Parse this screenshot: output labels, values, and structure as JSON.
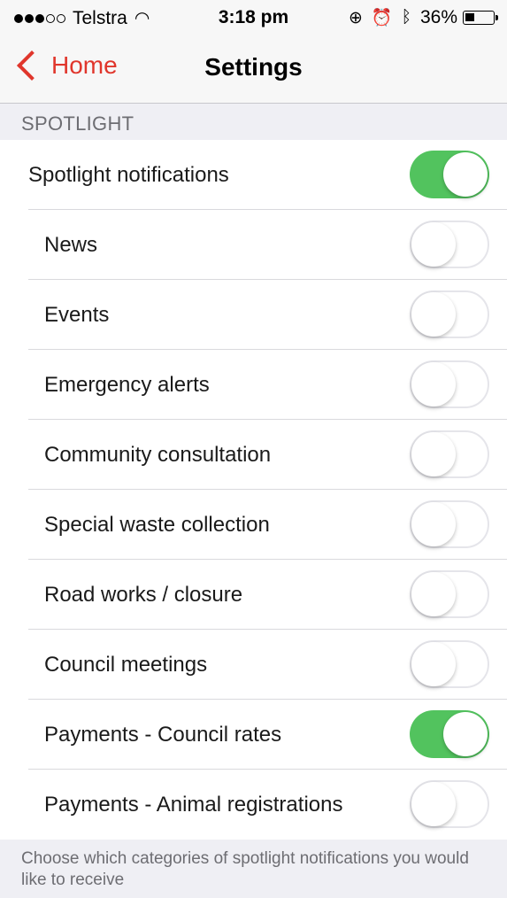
{
  "status_bar": {
    "carrier": "Telstra",
    "time": "3:18 pm",
    "battery": "36%",
    "battery_level": 0.36
  },
  "nav": {
    "back_label": "Home",
    "title": "Settings"
  },
  "section": {
    "header": "SPOTLIGHT",
    "footer": "Choose which categories of spotlight notifications you would like to receive"
  },
  "rows": [
    {
      "label": "Spotlight notifications",
      "on": true
    },
    {
      "label": "News",
      "on": false
    },
    {
      "label": "Events",
      "on": false
    },
    {
      "label": "Emergency alerts",
      "on": false
    },
    {
      "label": "Community consultation",
      "on": false
    },
    {
      "label": "Special waste collection",
      "on": false
    },
    {
      "label": "Road works / closure",
      "on": false
    },
    {
      "label": "Council meetings",
      "on": false
    },
    {
      "label": "Payments - Council rates",
      "on": true
    },
    {
      "label": "Payments - Animal registrations",
      "on": false
    }
  ],
  "colors": {
    "accent": "#e0362c",
    "switch_on": "#52c35e"
  }
}
